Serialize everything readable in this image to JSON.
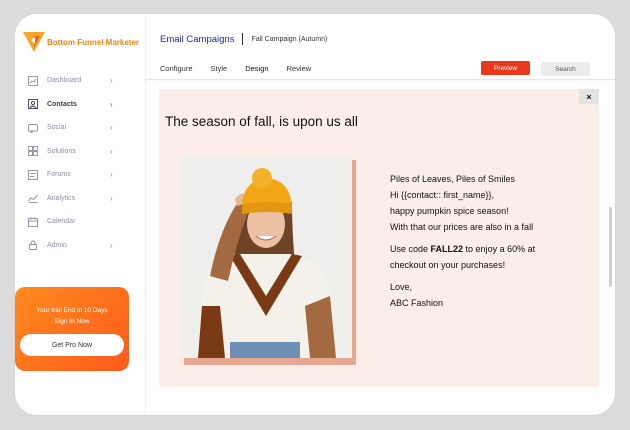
{
  "brand": {
    "name": "Bottom Funnel Marketer",
    "accent": "#f0830f"
  },
  "sidebar": {
    "items": [
      {
        "label": "Dashboard",
        "icon": "chart-icon",
        "chevron": true
      },
      {
        "label": "Contacts",
        "icon": "contacts-icon",
        "chevron": true,
        "active": true
      },
      {
        "label": "Social",
        "icon": "social-icon",
        "chevron": true
      },
      {
        "label": "Solutions",
        "icon": "solutions-icon",
        "chevron": true
      },
      {
        "label": "Forums",
        "icon": "forums-icon",
        "chevron": true
      },
      {
        "label": "Analytics",
        "icon": "analytics-icon",
        "chevron": true
      },
      {
        "label": "Calendar",
        "icon": "calendar-icon",
        "chevron": false
      },
      {
        "label": "Admin",
        "icon": "lock-icon",
        "chevron": true
      }
    ],
    "promo": {
      "line1": "Your trail End in 10 Days",
      "line2": "Sign In Now",
      "button": "Get Pro Now"
    }
  },
  "header": {
    "title": "Email Campaigns",
    "subtitle": "Fall Campaign (Autumn)",
    "tabs": [
      "Configure",
      "Style",
      "Design",
      "Review"
    ],
    "preview_label": "Preview",
    "search_label": "Search",
    "preview_color": "#e8391b"
  },
  "canvas": {
    "close_label": "×",
    "headline": "The season of fall, is upon us all",
    "copy": {
      "line1": "Piles of Leaves, Piles of Smiles",
      "line2": "Hi {{contact:: first_name}},",
      "line3": "happy pumpkin spice season!",
      "line4": "With that our prices are also in a fall",
      "code_pre": "Use code ",
      "code": "FALL22",
      "code_post": " to enjoy a 60% at",
      "line6": "checkout on your purchases!",
      "signoff": "Love,",
      "sender": "ABC Fashion"
    },
    "background": "#fbede8"
  }
}
